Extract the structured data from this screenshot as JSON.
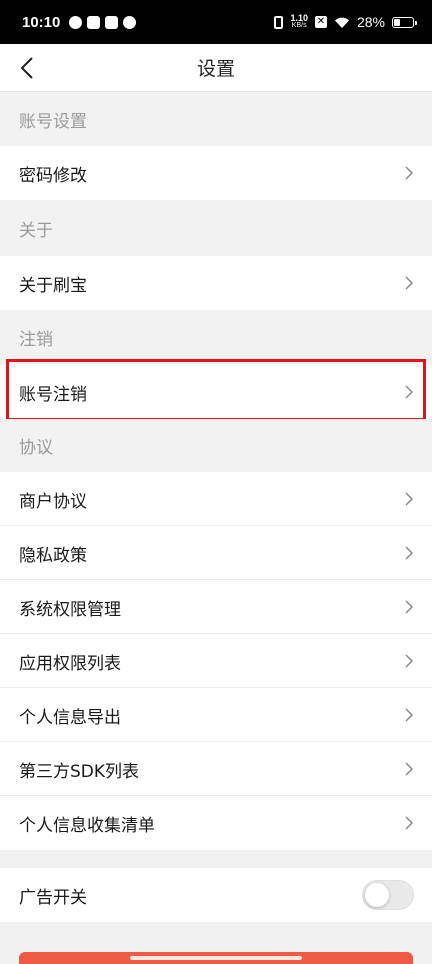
{
  "status_bar": {
    "time": "10:10",
    "net_speed_value": "1.10",
    "net_speed_unit": "KB/s",
    "battery": "28%"
  },
  "nav": {
    "title": "设置",
    "back_icon": "chevron-left-icon"
  },
  "sections": {
    "account": {
      "header": "账号设置",
      "items": [
        "密码修改"
      ]
    },
    "about": {
      "header": "关于",
      "items": [
        "关于刷宝"
      ]
    },
    "cancel": {
      "header": "注销",
      "items": [
        "账号注销"
      ]
    },
    "agreements": {
      "header": "协议",
      "items": [
        "商户协议",
        "隐私政策",
        "系统权限管理",
        "应用权限列表",
        "个人信息导出",
        "第三方SDK列表",
        "个人信息收集清单"
      ]
    },
    "ads": {
      "label": "广告开关",
      "enabled": false
    }
  },
  "colors": {
    "highlight": "#e0141e",
    "button": "#ef5a45",
    "section_bg": "#f2f2f2"
  }
}
